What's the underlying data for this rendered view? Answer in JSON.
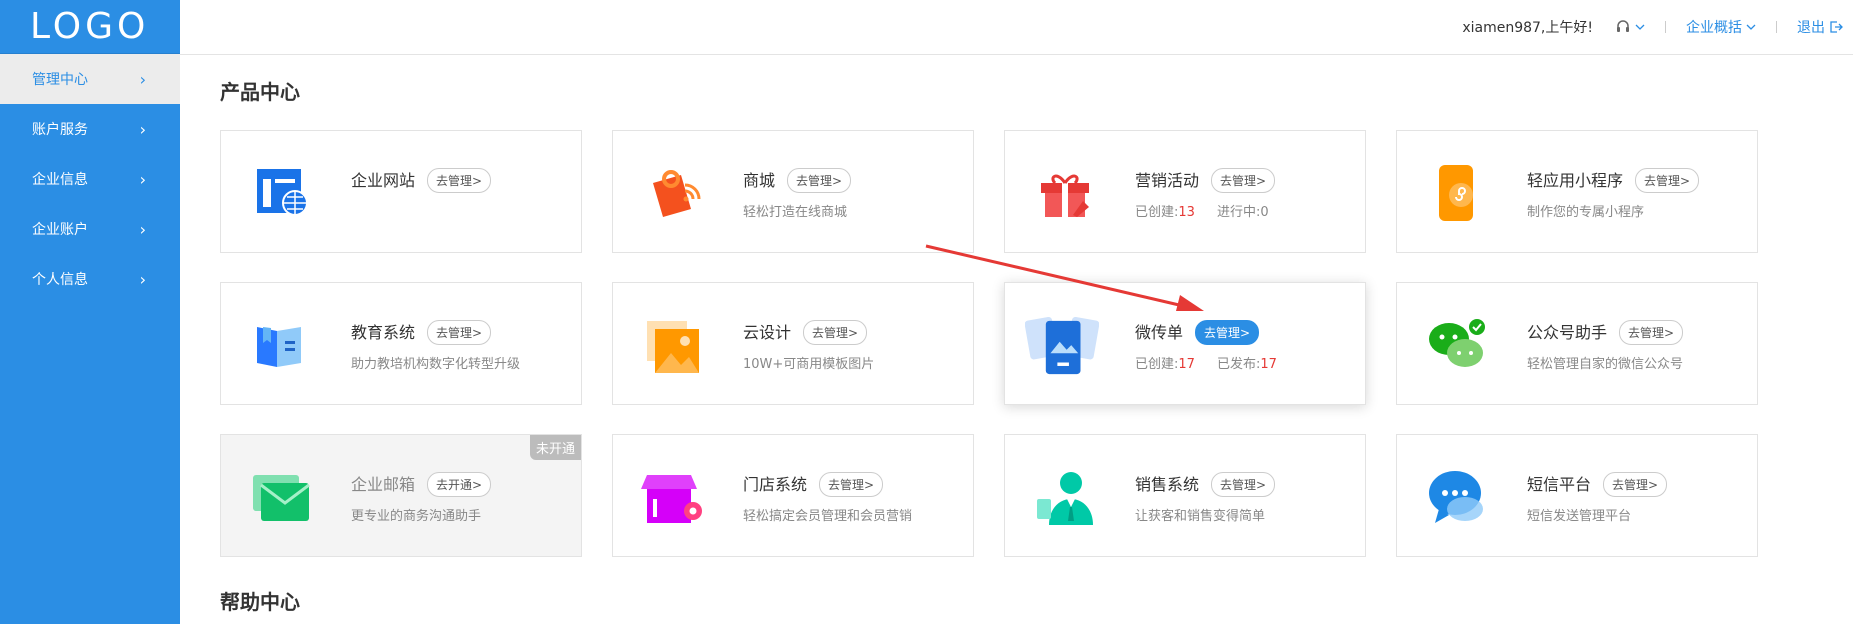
{
  "sidebar": {
    "logo": "LOGO",
    "items": [
      {
        "label": "管理中心"
      },
      {
        "label": "账户服务"
      },
      {
        "label": "企业信息"
      },
      {
        "label": "企业账户"
      },
      {
        "label": "个人信息"
      }
    ]
  },
  "topbar": {
    "greeting": "xiamen987,上午好!",
    "overview": "企业概括",
    "logout": "退出"
  },
  "sections": {
    "products": "产品中心",
    "help": "帮助中心"
  },
  "cards": [
    {
      "name": "企业网站",
      "action": "去管理>",
      "desc": ""
    },
    {
      "name": "商城",
      "action": "去管理>",
      "desc": "轻松打造在线商城"
    },
    {
      "name": "营销活动",
      "action": "去管理>",
      "stats": {
        "created_label": "已创建:",
        "created": "13",
        "running_label": "进行中:",
        "running": "0"
      }
    },
    {
      "name": "轻应用小程序",
      "action": "去管理>",
      "desc": "制作您的专属小程序"
    },
    {
      "name": "教育系统",
      "action": "去管理>",
      "desc": "助力教培机构数字化转型升级"
    },
    {
      "name": "云设计",
      "action": "去管理>",
      "desc": "10W+可商用模板图片"
    },
    {
      "name": "微传单",
      "action": "去管理>",
      "stats": {
        "created_label": "已创建:",
        "created": "17",
        "published_label": "已发布:",
        "published": "17"
      }
    },
    {
      "name": "公众号助手",
      "action": "去管理>",
      "desc": "轻松管理自家的微信公众号"
    },
    {
      "name": "企业邮箱",
      "action": "去开通>",
      "desc": "更专业的商务沟通助手",
      "badge": "未开通"
    },
    {
      "name": "门店系统",
      "action": "去管理>",
      "desc": "轻松搞定会员管理和会员营销"
    },
    {
      "name": "销售系统",
      "action": "去管理>",
      "desc": "让获客和销售变得简单"
    },
    {
      "name": "短信平台",
      "action": "去管理>",
      "desc": "短信发送管理平台"
    }
  ],
  "colors": {
    "primary": "#2b8ee4",
    "stat_red": "#e53935",
    "annotation_arrow": "#e53935"
  }
}
